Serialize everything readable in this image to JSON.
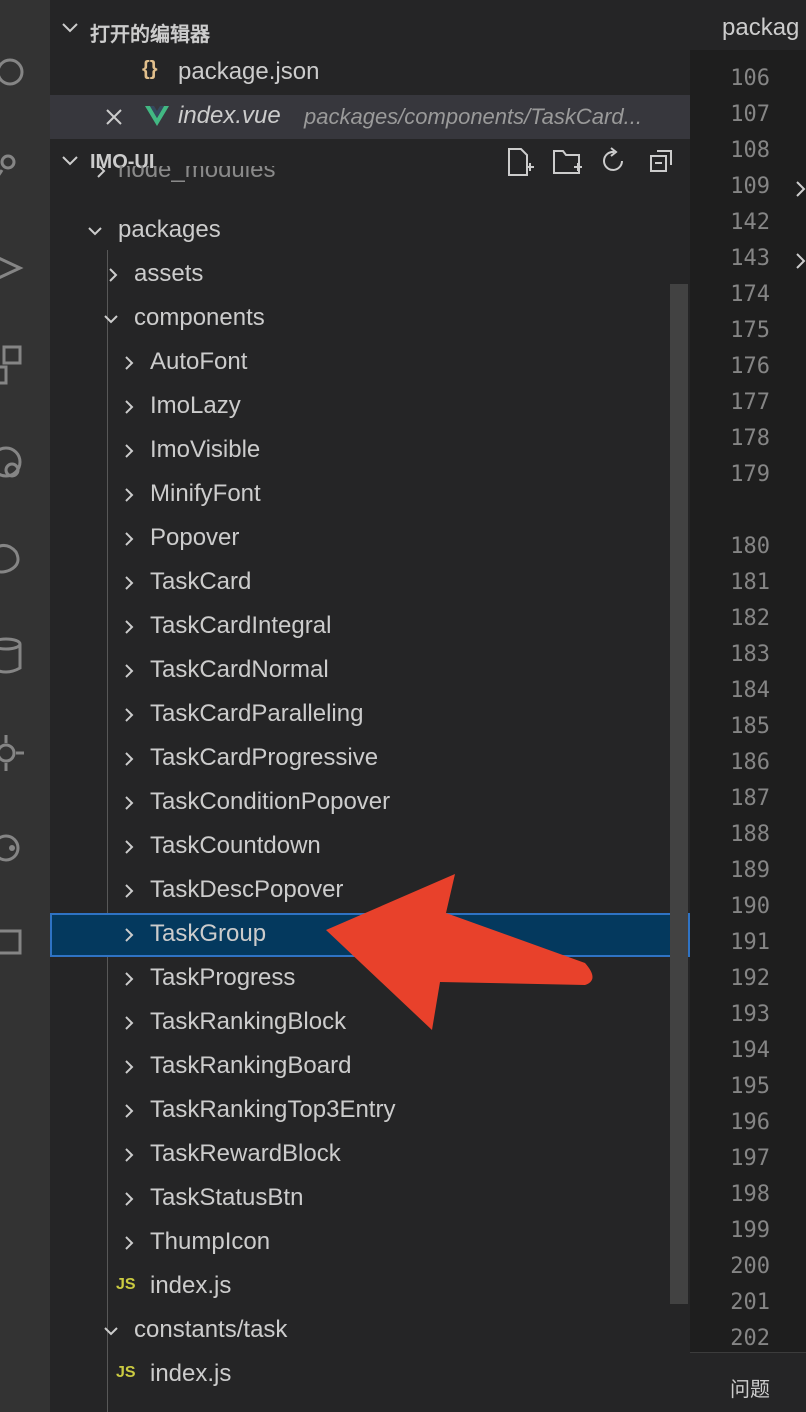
{
  "activity_bar": {
    "icons": [
      "search-icon",
      "source-control-icon",
      "run-debug-icon",
      "extensions-icon",
      "remote-icon",
      "docker-icon",
      "database-icon",
      "settings-cog-icon",
      "accounts-icon",
      "chat-icon"
    ]
  },
  "explorer": {
    "open_editors": {
      "title": "打开的编辑器",
      "items": [
        {
          "name": "package.json",
          "icon": "json-braces-icon",
          "icon_text": "{}",
          "description": ""
        },
        {
          "name": "index.vue",
          "icon": "vue-icon",
          "description": "packages/components/TaskCard..."
        }
      ]
    },
    "workspace": {
      "title": "IMO-UI",
      "actions": [
        "new-file-icon",
        "new-folder-icon",
        "refresh-icon",
        "collapse-all-icon"
      ],
      "tree": {
        "node_modules": "node_modules",
        "packages": "packages",
        "assets": "assets",
        "components": "components",
        "component_folders": [
          "AutoFont",
          "ImoLazy",
          "ImoVisible",
          "MinifyFont",
          "Popover",
          "TaskCard",
          "TaskCardIntegral",
          "TaskCardNormal",
          "TaskCardParalleling",
          "TaskCardProgressive",
          "TaskConditionPopover",
          "TaskCountdown",
          "TaskDescPopover",
          "TaskGroup",
          "TaskProgress",
          "TaskRankingBlock",
          "TaskRankingBoard",
          "TaskRankingTop3Entry",
          "TaskRewardBlock",
          "TaskStatusBtn",
          "ThumpIcon"
        ],
        "selected": "TaskGroup",
        "components_index": "index.js",
        "js_badge": "JS",
        "constants_task": "constants/task",
        "constants_index": "index.js"
      }
    }
  },
  "editor": {
    "tab_label": "packag",
    "line_numbers": [
      "106",
      "107",
      "108",
      "109",
      "142",
      "143",
      "174",
      "175",
      "176",
      "177",
      "178",
      "179",
      "180",
      "181",
      "182",
      "183",
      "184",
      "185",
      "186",
      "187",
      "188",
      "189",
      "190",
      "191",
      "192",
      "193",
      "194",
      "195",
      "196",
      "197",
      "198",
      "199",
      "200",
      "201",
      "202"
    ],
    "folded_lines": [
      "109",
      "143"
    ],
    "panel_label": "问题"
  },
  "annotation": {
    "arrow_color": "#e8412b"
  },
  "colors": {
    "selection": "#04395e",
    "selection_border": "#2f73c4",
    "vue": "#42b883",
    "json": "#e2c08d",
    "js": "#cbcb41"
  }
}
